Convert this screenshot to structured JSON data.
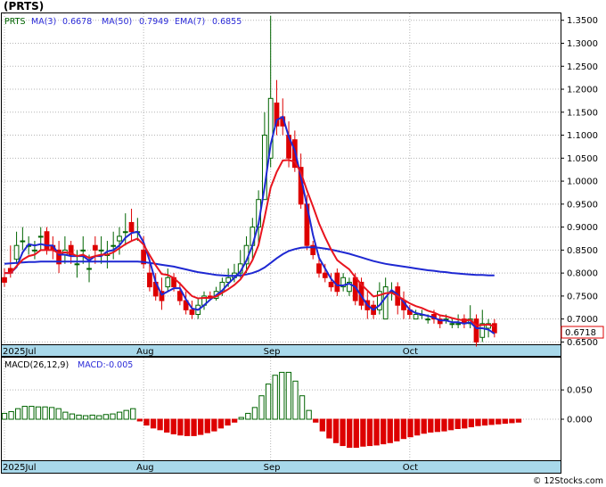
{
  "title": "(PRTS)",
  "legend": {
    "symbol": "PRTS",
    "items": [
      {
        "label": "MA(3)",
        "value": "0.6678",
        "color": "#2a2ad8"
      },
      {
        "label": "MA(50)",
        "value": "0.7949",
        "color": "#2a2ad8"
      },
      {
        "label": "EMA(7)",
        "value": "0.6855",
        "color": "#2a2ad8"
      }
    ]
  },
  "last_price": "0.6718",
  "month_labels": [
    "2025Jul",
    "Aug",
    "Sep",
    "Oct"
  ],
  "price_ticks": [
    "1.3500",
    "1.3000",
    "1.2500",
    "1.2000",
    "1.1500",
    "1.1000",
    "1.0500",
    "1.0000",
    "0.9500",
    "0.9000",
    "0.8500",
    "0.8000",
    "0.7500",
    "0.7000",
    "0.6500"
  ],
  "macd_legend": {
    "label": "MACD(26,12,9)",
    "value_label": "MACD:-0.005"
  },
  "macd_ticks": [
    "0.050",
    "0.000"
  ],
  "watermark": "© 12Stocks.com",
  "colors": {
    "up": "#006400",
    "down": "#dd0000",
    "ma_fast": "#1e28d2",
    "ma_slow": "#e8141e",
    "axis_bar": "#a8d8ea",
    "grid": "#b4b4b4"
  },
  "chart_data": [
    {
      "type": "candlestick",
      "title": "(PRTS)",
      "ylim": [
        0.645,
        1.365
      ],
      "yticks": [
        1.35,
        1.3,
        1.25,
        1.2,
        1.15,
        1.1,
        1.05,
        1.0,
        0.95,
        0.9,
        0.85,
        0.8,
        0.75,
        0.7,
        0.65
      ],
      "x": [
        "2025-06-30",
        "2025-07-01",
        "2025-07-02",
        "2025-07-03",
        "2025-07-07",
        "2025-07-08",
        "2025-07-09",
        "2025-07-10",
        "2025-07-11",
        "2025-07-14",
        "2025-07-15",
        "2025-07-16",
        "2025-07-17",
        "2025-07-18",
        "2025-07-21",
        "2025-07-22",
        "2025-07-23",
        "2025-07-24",
        "2025-07-25",
        "2025-07-28",
        "2025-07-29",
        "2025-07-30",
        "2025-07-31",
        "2025-08-01",
        "2025-08-04",
        "2025-08-05",
        "2025-08-06",
        "2025-08-07",
        "2025-08-08",
        "2025-08-11",
        "2025-08-12",
        "2025-08-13",
        "2025-08-14",
        "2025-08-15",
        "2025-08-18",
        "2025-08-19",
        "2025-08-20",
        "2025-08-21",
        "2025-08-22",
        "2025-08-25",
        "2025-08-26",
        "2025-08-27",
        "2025-08-28",
        "2025-08-29",
        "2025-09-02",
        "2025-09-03",
        "2025-09-04",
        "2025-09-05",
        "2025-09-08",
        "2025-09-09",
        "2025-09-10",
        "2025-09-11",
        "2025-09-12",
        "2025-09-15",
        "2025-09-16",
        "2025-09-17",
        "2025-09-18",
        "2025-09-19",
        "2025-09-22",
        "2025-09-23",
        "2025-09-24",
        "2025-09-25",
        "2025-09-26",
        "2025-09-29",
        "2025-09-30",
        "2025-10-01",
        "2025-10-02",
        "2025-10-03",
        "2025-10-06",
        "2025-10-07",
        "2025-10-08",
        "2025-10-09",
        "2025-10-10",
        "2025-10-13",
        "2025-10-14",
        "2025-10-15",
        "2025-10-16",
        "2025-10-17",
        "2025-10-20",
        "2025-10-21",
        "2025-10-22",
        "2025-10-23",
        "2025-10-24",
        "2025-10-27",
        "2025-10-28",
        "2025-10-29"
      ],
      "open": [
        0.79,
        0.81,
        0.83,
        0.87,
        0.86,
        0.85,
        0.88,
        0.89,
        0.86,
        0.85,
        0.84,
        0.86,
        0.82,
        0.85,
        0.81,
        0.86,
        0.85,
        0.84,
        0.86,
        0.87,
        0.89,
        0.91,
        0.89,
        0.85,
        0.8,
        0.78,
        0.76,
        0.77,
        0.79,
        0.76,
        0.74,
        0.72,
        0.71,
        0.73,
        0.75,
        0.745,
        0.76,
        0.78,
        0.79,
        0.8,
        0.82,
        0.86,
        0.9,
        0.96,
        1.05,
        1.17,
        1.14,
        1.1,
        1.09,
        1.03,
        0.95,
        0.86,
        0.82,
        0.8,
        0.78,
        0.8,
        0.77,
        0.76,
        0.79,
        0.78,
        0.74,
        0.73,
        0.72,
        0.7,
        0.76,
        0.77,
        0.74,
        0.72,
        0.7,
        0.71,
        0.7,
        0.71,
        0.7,
        0.7,
        0.69,
        0.69,
        0.7,
        0.69,
        0.7,
        0.66,
        0.68,
        0.69
      ],
      "close": [
        0.78,
        0.8,
        0.86,
        0.87,
        0.86,
        0.85,
        0.88,
        0.85,
        0.85,
        0.82,
        0.85,
        0.84,
        0.82,
        0.85,
        0.81,
        0.85,
        0.85,
        0.84,
        0.86,
        0.88,
        0.89,
        0.89,
        0.89,
        0.82,
        0.77,
        0.75,
        0.74,
        0.79,
        0.77,
        0.74,
        0.72,
        0.71,
        0.73,
        0.75,
        0.745,
        0.76,
        0.78,
        0.79,
        0.8,
        0.82,
        0.86,
        0.9,
        0.96,
        1.1,
        1.18,
        1.12,
        1.12,
        1.05,
        1.03,
        0.95,
        0.86,
        0.84,
        0.8,
        0.79,
        0.77,
        0.76,
        0.79,
        0.78,
        0.74,
        0.73,
        0.72,
        0.71,
        0.76,
        0.77,
        0.76,
        0.73,
        0.72,
        0.71,
        0.71,
        0.71,
        0.7,
        0.7,
        0.69,
        0.7,
        0.69,
        0.69,
        0.69,
        0.7,
        0.65,
        0.69,
        0.69,
        0.67
      ],
      "high": [
        0.81,
        0.86,
        0.89,
        0.9,
        0.88,
        0.87,
        0.9,
        0.9,
        0.88,
        0.87,
        0.88,
        0.87,
        0.85,
        0.88,
        0.84,
        0.88,
        0.88,
        0.87,
        0.89,
        0.9,
        0.93,
        0.94,
        0.92,
        0.88,
        0.82,
        0.8,
        0.79,
        0.81,
        0.8,
        0.78,
        0.76,
        0.74,
        0.745,
        0.76,
        0.76,
        0.77,
        0.79,
        0.81,
        0.82,
        0.85,
        0.88,
        0.92,
        0.98,
        1.15,
        1.36,
        1.22,
        1.18,
        1.13,
        1.11,
        1.06,
        0.97,
        0.87,
        0.84,
        0.82,
        0.8,
        0.81,
        0.8,
        0.79,
        0.8,
        0.79,
        0.76,
        0.74,
        0.78,
        0.79,
        0.78,
        0.78,
        0.76,
        0.73,
        0.72,
        0.72,
        0.71,
        0.72,
        0.71,
        0.71,
        0.7,
        0.71,
        0.71,
        0.73,
        0.71,
        0.72,
        0.7,
        0.7
      ],
      "low": [
        0.77,
        0.79,
        0.82,
        0.85,
        0.84,
        0.83,
        0.85,
        0.84,
        0.83,
        0.8,
        0.82,
        0.82,
        0.79,
        0.82,
        0.78,
        0.82,
        0.82,
        0.81,
        0.83,
        0.84,
        0.86,
        0.87,
        0.87,
        0.81,
        0.76,
        0.74,
        0.72,
        0.76,
        0.76,
        0.73,
        0.71,
        0.7,
        0.7,
        0.72,
        0.74,
        0.74,
        0.75,
        0.77,
        0.78,
        0.79,
        0.8,
        0.83,
        0.86,
        0.96,
        1.03,
        1.1,
        1.1,
        1.03,
        1.02,
        0.94,
        0.85,
        0.83,
        0.79,
        0.78,
        0.76,
        0.75,
        0.76,
        0.75,
        0.73,
        0.72,
        0.7,
        0.7,
        0.71,
        0.75,
        0.74,
        0.71,
        0.7,
        0.7,
        0.7,
        0.7,
        0.69,
        0.69,
        0.68,
        0.69,
        0.68,
        0.68,
        0.68,
        0.68,
        0.64,
        0.65,
        0.66,
        0.66
      ],
      "series_overlays": [
        {
          "name": "MA(3)",
          "color": "#1e28d2",
          "values": [
            0.8,
            0.8,
            0.813,
            0.845,
            0.863,
            0.86,
            0.863,
            0.86,
            0.86,
            0.84,
            0.84,
            0.837,
            0.837,
            0.837,
            0.827,
            0.837,
            0.837,
            0.847,
            0.85,
            0.86,
            0.877,
            0.887,
            0.89,
            0.867,
            0.827,
            0.78,
            0.753,
            0.76,
            0.767,
            0.767,
            0.743,
            0.723,
            0.72,
            0.73,
            0.742,
            0.752,
            0.762,
            0.777,
            0.79,
            0.803,
            0.827,
            0.86,
            0.907,
            0.987,
            1.08,
            1.133,
            1.14,
            1.097,
            1.067,
            1.01,
            0.947,
            0.883,
            0.833,
            0.81,
            0.787,
            0.773,
            0.773,
            0.777,
            0.77,
            0.75,
            0.73,
            0.72,
            0.73,
            0.747,
            0.763,
            0.753,
            0.737,
            0.72,
            0.713,
            0.71,
            0.707,
            0.703,
            0.697,
            0.697,
            0.693,
            0.693,
            0.69,
            0.693,
            0.68,
            0.68,
            0.677,
            0.668
          ]
        },
        {
          "name": "MA(50)",
          "color": "#1e28d2",
          "values": [
            0.82,
            0.821,
            0.822,
            0.823,
            0.824,
            0.824,
            0.825,
            0.825,
            0.825,
            0.825,
            0.825,
            0.825,
            0.825,
            0.825,
            0.825,
            0.825,
            0.825,
            0.825,
            0.825,
            0.825,
            0.825,
            0.825,
            0.825,
            0.824,
            0.822,
            0.82,
            0.818,
            0.816,
            0.814,
            0.811,
            0.808,
            0.805,
            0.802,
            0.8,
            0.798,
            0.796,
            0.795,
            0.794,
            0.794,
            0.795,
            0.797,
            0.8,
            0.805,
            0.812,
            0.822,
            0.832,
            0.841,
            0.848,
            0.852,
            0.855,
            0.856,
            0.856,
            0.855,
            0.853,
            0.851,
            0.848,
            0.845,
            0.842,
            0.838,
            0.834,
            0.83,
            0.826,
            0.823,
            0.82,
            0.818,
            0.816,
            0.814,
            0.812,
            0.81,
            0.808,
            0.806,
            0.805,
            0.803,
            0.802,
            0.8,
            0.799,
            0.798,
            0.797,
            0.796,
            0.796,
            0.795,
            0.795
          ]
        },
        {
          "name": "EMA(7)",
          "color": "#e8141e",
          "values": [
            0.8,
            0.8,
            0.815,
            0.829,
            0.837,
            0.84,
            0.85,
            0.85,
            0.85,
            0.843,
            0.845,
            0.843,
            0.837,
            0.84,
            0.833,
            0.837,
            0.84,
            0.84,
            0.845,
            0.854,
            0.863,
            0.87,
            0.875,
            0.862,
            0.839,
            0.817,
            0.798,
            0.796,
            0.789,
            0.777,
            0.763,
            0.75,
            0.745,
            0.746,
            0.746,
            0.749,
            0.757,
            0.765,
            0.774,
            0.786,
            0.805,
            0.828,
            0.861,
            0.921,
            0.986,
            1.02,
            1.045,
            1.046,
            1.042,
            1.019,
            0.98,
            0.945,
            0.908,
            0.878,
            0.851,
            0.828,
            0.818,
            0.808,
            0.791,
            0.775,
            0.762,
            0.749,
            0.752,
            0.756,
            0.757,
            0.75,
            0.742,
            0.734,
            0.728,
            0.724,
            0.718,
            0.714,
            0.708,
            0.706,
            0.702,
            0.699,
            0.697,
            0.698,
            0.686,
            0.687,
            0.688,
            0.684
          ]
        }
      ]
    },
    {
      "type": "bar",
      "title": "MACD(26,12,9)",
      "ylim": [
        -0.07,
        0.105
      ],
      "yticks": [
        0.05,
        0.0
      ],
      "values": [
        0.01,
        0.013,
        0.018,
        0.022,
        0.022,
        0.021,
        0.021,
        0.02,
        0.018,
        0.012,
        0.009,
        0.007,
        0.006,
        0.007,
        0.006,
        0.008,
        0.009,
        0.012,
        0.015,
        0.018,
        -0.003,
        -0.01,
        -0.015,
        -0.018,
        -0.022,
        -0.025,
        -0.027,
        -0.028,
        -0.028,
        -0.026,
        -0.023,
        -0.02,
        -0.015,
        -0.01,
        -0.005,
        0.003,
        0.01,
        0.02,
        0.04,
        0.06,
        0.075,
        0.08,
        0.08,
        0.065,
        0.04,
        0.015,
        -0.005,
        -0.02,
        -0.032,
        -0.04,
        -0.045,
        -0.048,
        -0.048,
        -0.046,
        -0.045,
        -0.044,
        -0.042,
        -0.04,
        -0.037,
        -0.033,
        -0.03,
        -0.027,
        -0.024,
        -0.022,
        -0.021,
        -0.02,
        -0.018,
        -0.016,
        -0.015,
        -0.013,
        -0.011,
        -0.01,
        -0.009,
        -0.008,
        -0.007,
        -0.006,
        -0.005
      ]
    }
  ]
}
